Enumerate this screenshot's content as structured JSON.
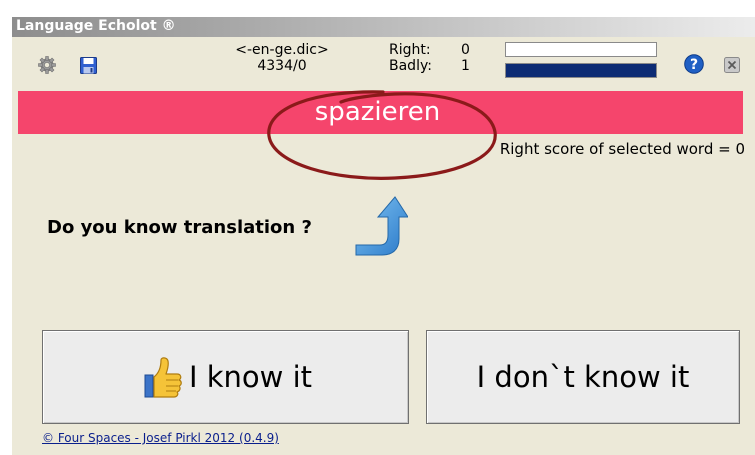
{
  "window": {
    "title": "Language Echolot ®"
  },
  "toolbar": {
    "settings_icon": "gear-icon",
    "save_icon": "save-icon",
    "help_icon": "help-icon",
    "close_icon": "close-icon"
  },
  "dictionary": {
    "name": "<-en-ge.dic>",
    "counts": "4334/0"
  },
  "stats": {
    "right_label": "Right:",
    "right_value": "0",
    "badly_label": "Badly:",
    "badly_value": "1",
    "right_bar_fill": 0,
    "badly_bar_fill": 1.0,
    "bar_color": "#0c2b74"
  },
  "word": {
    "text": "spazieren",
    "band_color": "#f5456c"
  },
  "score": {
    "text": "Right score of selected word = 0"
  },
  "prompt": {
    "question": "Do you know translation ?"
  },
  "buttons": {
    "know": "I know it",
    "dont_know": "I don`t know it"
  },
  "footer": {
    "copyright": "© Four Spaces - Josef Pirkl 2012 (0.4.9)"
  }
}
